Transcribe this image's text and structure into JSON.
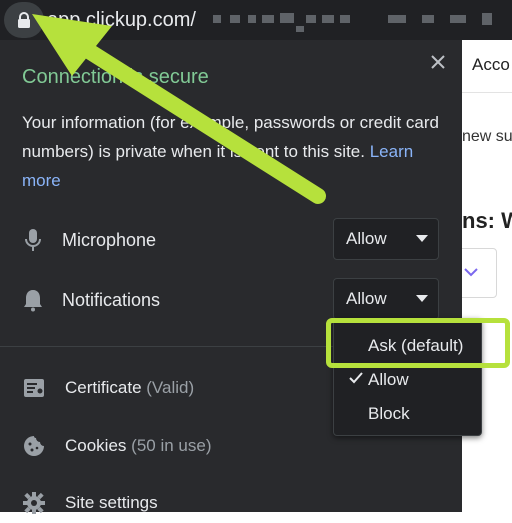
{
  "browser": {
    "url_host": "app.clickup.com/",
    "lock_icon": "lock-icon"
  },
  "page": {
    "tab_label": "Acco",
    "text1": "new su",
    "text2": "ns: W"
  },
  "popup": {
    "title": "Connection is secure",
    "info_text": "Your information (for example, passwords or credit card numbers) is private when it is sent to this site.",
    "learn_more": "Learn more",
    "permissions": [
      {
        "label": "Microphone",
        "value": "Allow",
        "icon": "microphone-icon"
      },
      {
        "label": "Notifications",
        "value": "Allow",
        "icon": "bell-icon"
      }
    ],
    "site_items": [
      {
        "label": "Certificate",
        "sub": "(Valid)",
        "icon": "certificate-icon"
      },
      {
        "label": "Cookies",
        "sub": "(50 in use)",
        "icon": "cookie-icon"
      },
      {
        "label": "Site settings",
        "sub": "",
        "icon": "gear-icon"
      }
    ]
  },
  "dropdown": {
    "options": [
      "Ask (default)",
      "Allow",
      "Block"
    ],
    "selected": "Allow"
  },
  "colors": {
    "popup_bg": "#292a2d",
    "secure_green": "#81c995",
    "link_blue": "#8ab4f8",
    "annotation_green": "#b6e13c"
  }
}
